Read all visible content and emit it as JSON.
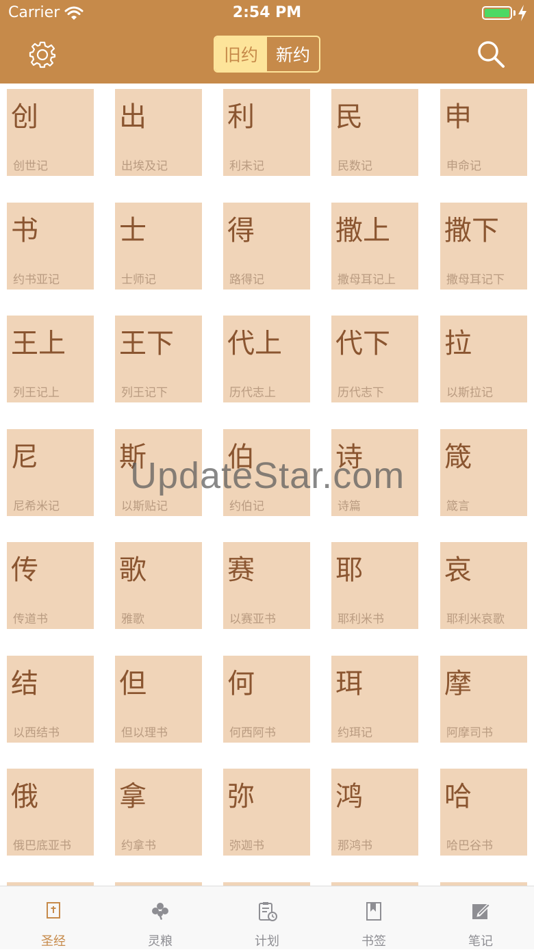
{
  "status_bar": {
    "carrier": "Carrier",
    "time": "2:54 PM",
    "wifi_icon": "wifi-icon",
    "battery_icon": "battery-icon",
    "charging_icon": "charging-bolt-icon"
  },
  "nav": {
    "settings_icon": "gear-icon",
    "search_icon": "search-icon",
    "segments": [
      {
        "label": "旧约",
        "selected": true
      },
      {
        "label": "新约",
        "selected": false
      }
    ]
  },
  "books": [
    {
      "abbr": "创",
      "name": "创世记"
    },
    {
      "abbr": "出",
      "name": "出埃及记"
    },
    {
      "abbr": "利",
      "name": "利未记"
    },
    {
      "abbr": "民",
      "name": "民数记"
    },
    {
      "abbr": "申",
      "name": "申命记"
    },
    {
      "abbr": "书",
      "name": "约书亚记"
    },
    {
      "abbr": "士",
      "name": "士师记"
    },
    {
      "abbr": "得",
      "name": "路得记"
    },
    {
      "abbr": "撒上",
      "name": "撒母耳记上"
    },
    {
      "abbr": "撒下",
      "name": "撒母耳记下"
    },
    {
      "abbr": "王上",
      "name": "列王记上"
    },
    {
      "abbr": "王下",
      "name": "列王记下"
    },
    {
      "abbr": "代上",
      "name": "历代志上"
    },
    {
      "abbr": "代下",
      "name": "历代志下"
    },
    {
      "abbr": "拉",
      "name": "以斯拉记"
    },
    {
      "abbr": "尼",
      "name": "尼希米记"
    },
    {
      "abbr": "斯",
      "name": "以斯贴记"
    },
    {
      "abbr": "伯",
      "name": "约伯记"
    },
    {
      "abbr": "诗",
      "name": "诗篇"
    },
    {
      "abbr": "箴",
      "name": "箴言"
    },
    {
      "abbr": "传",
      "name": "传道书"
    },
    {
      "abbr": "歌",
      "name": "雅歌"
    },
    {
      "abbr": "赛",
      "name": "以赛亚书"
    },
    {
      "abbr": "耶",
      "name": "耶利米书"
    },
    {
      "abbr": "哀",
      "name": "耶利米哀歌"
    },
    {
      "abbr": "结",
      "name": "以西结书"
    },
    {
      "abbr": "但",
      "name": "但以理书"
    },
    {
      "abbr": "何",
      "name": "何西阿书"
    },
    {
      "abbr": "珥",
      "name": "约珥记"
    },
    {
      "abbr": "摩",
      "name": "阿摩司书"
    },
    {
      "abbr": "俄",
      "name": "俄巴底亚书"
    },
    {
      "abbr": "拿",
      "name": "约拿书"
    },
    {
      "abbr": "弥",
      "name": "弥迦书"
    },
    {
      "abbr": "鸿",
      "name": "那鸿书"
    },
    {
      "abbr": "哈",
      "name": "哈巴谷书"
    }
  ],
  "watermark": "UpdateStar.com",
  "tabs": [
    {
      "label": "圣经",
      "icon": "bible-icon",
      "active": true
    },
    {
      "label": "灵粮",
      "icon": "clover-icon",
      "active": false
    },
    {
      "label": "计划",
      "icon": "plan-clipboard-icon",
      "active": false
    },
    {
      "label": "书签",
      "icon": "bookmark-icon",
      "active": false
    },
    {
      "label": "笔记",
      "icon": "note-edit-icon",
      "active": false
    }
  ],
  "colors": {
    "accent": "#c68a4a",
    "tile_bg": "#f0d4b8",
    "tile_text": "#8a5530",
    "tile_subtext": "#b99b81",
    "segment_selected": "#fde49a"
  }
}
